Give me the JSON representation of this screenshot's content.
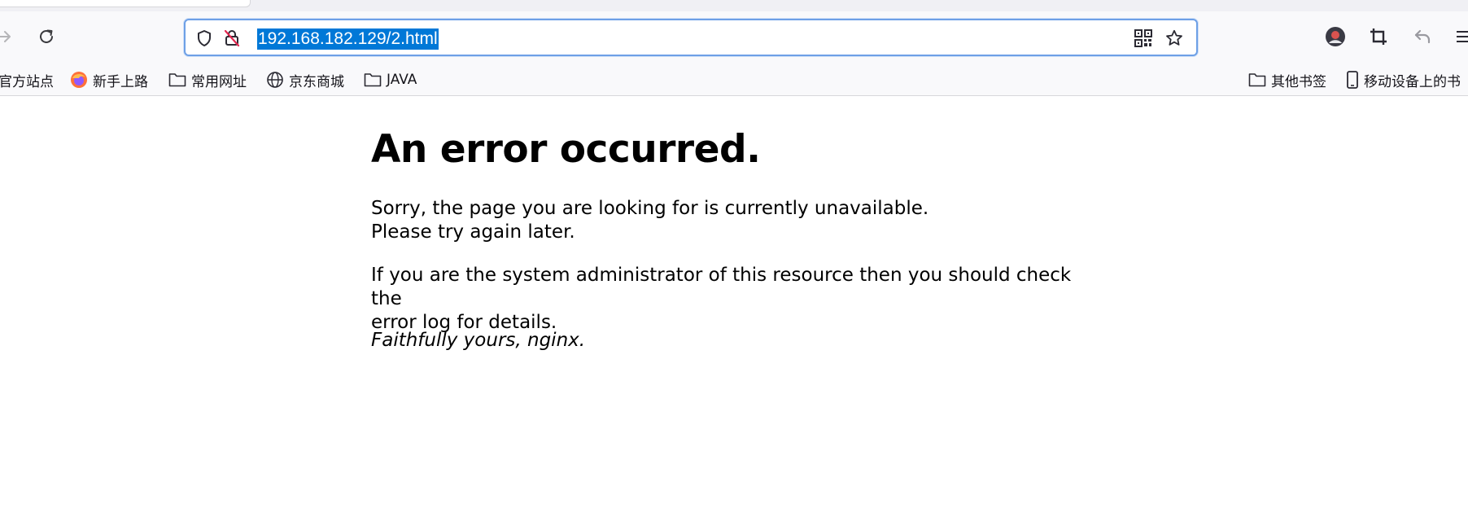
{
  "browser": {
    "address_bar": {
      "url": "192.168.182.129/2.html"
    },
    "bookmarks": [
      {
        "label": "官方站点",
        "icon": "partial-cut-icon"
      },
      {
        "label": "新手上路",
        "icon": "firefox-icon"
      },
      {
        "label": "常用网址",
        "icon": "folder-icon"
      },
      {
        "label": "京东商城",
        "icon": "globe-icon"
      },
      {
        "label": "JAVA",
        "icon": "folder-icon"
      }
    ],
    "other_bookmarks": {
      "label": "其他书签",
      "icon": "folder-icon"
    },
    "mobile_bookmarks": {
      "label": "移动设备上的书",
      "icon": "mobile-icon"
    }
  },
  "page": {
    "heading": "An error occurred.",
    "para1_line1": "Sorry, the page you are looking for is currently unavailable.",
    "para1_line2": "Please try again later.",
    "para2_line1": "If you are the system administrator of this resource then you should check the",
    "para2_line2": "error log for details.",
    "signature": "Faithfully yours, nginx."
  },
  "colors": {
    "selection": "#0078d7",
    "urlbar_focus": "#6ea0e6",
    "toolbar_bg": "#f9f9fb"
  }
}
